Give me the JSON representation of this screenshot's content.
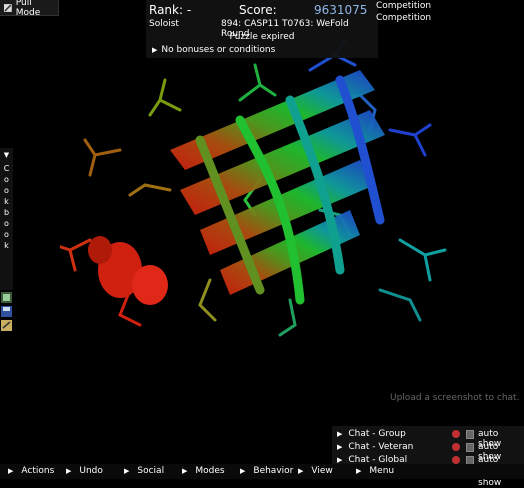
{
  "pull_mode": {
    "label": "Pull Mode",
    "icon": "pull-mode-icon"
  },
  "score_panel": {
    "rank_label": "Rank: -",
    "score_label": "Score:",
    "score_value": "9631075",
    "mode": "Soloist",
    "puzzle": "894: CASP11 T0763: WeFold Round",
    "status": "Puzzle expired",
    "bonuses": "No bonuses or conditions"
  },
  "competition": {
    "line1": "Competition",
    "line2": "Competition"
  },
  "cookbook": {
    "label": "Cookbook",
    "letters": [
      "C",
      "o",
      "o",
      "k",
      "b",
      "o",
      "o",
      "k"
    ]
  },
  "side_icons": [
    "recipe-icon",
    "save-icon",
    "notes-icon"
  ],
  "upload_hint": "Upload a screenshot to chat.",
  "chat": {
    "rows": [
      {
        "label": "Chat - Group",
        "status_color": "#c03030",
        "auto": "auto show"
      },
      {
        "label": "Chat - Veteran",
        "status_color": "#c03030",
        "auto": "auto show"
      },
      {
        "label": "Chat - Global",
        "status_color": "#c03030",
        "auto": "auto show"
      },
      {
        "label": "",
        "status_color": "#40d040",
        "auto": "auto show"
      }
    ]
  },
  "bottom_menu": [
    "Actions",
    "Undo",
    "Social",
    "Modes",
    "Behavior",
    "View",
    "Menu"
  ],
  "colors": {
    "background": "#000000",
    "score_value": "#8fb7e8",
    "panel": "#121212"
  }
}
